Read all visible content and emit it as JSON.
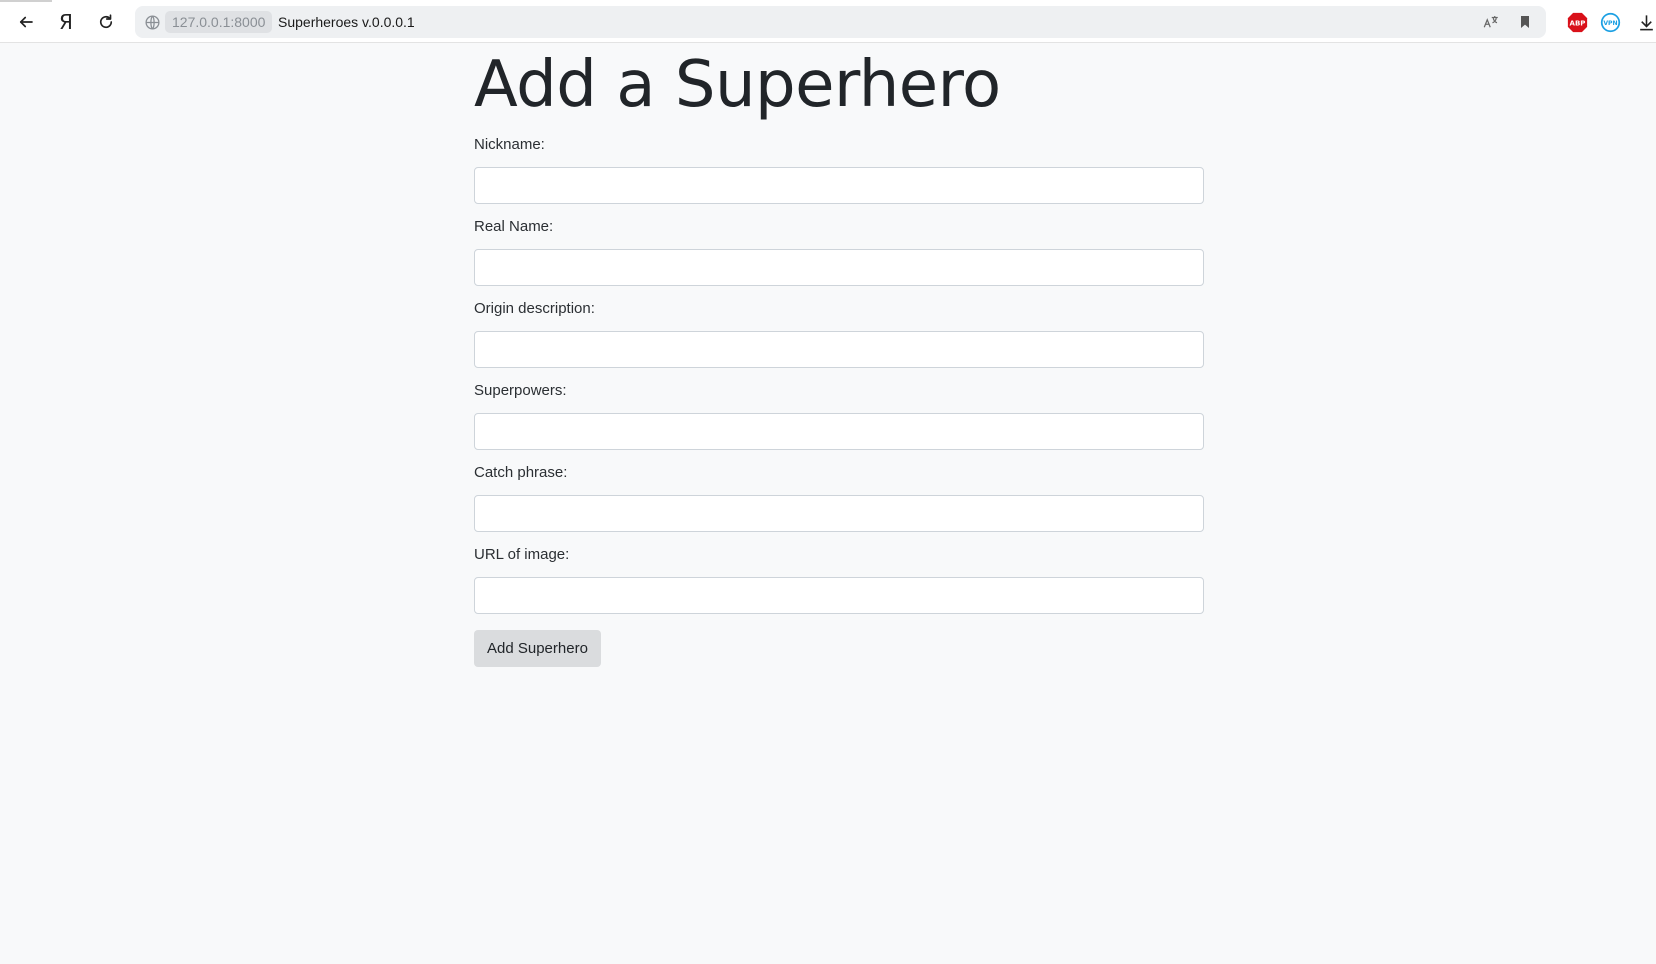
{
  "browser": {
    "host": "127.0.0.1:8000",
    "page_title": "Superheroes v.0.0.0.1",
    "icons": {
      "back": "back-arrow-icon",
      "yandex": "yandex-icon",
      "reload": "reload-icon",
      "site_info": "globe-icon",
      "translate": "translate-icon",
      "bookmark": "bookmark-icon",
      "adblock": "adblock-plus-icon",
      "vpn": "vpn-icon",
      "downloads": "download-icon"
    },
    "yandex_glyph": "Я",
    "adblock_text": "ABP",
    "vpn_text": "VPN",
    "colors": {
      "adblock": "#d9111a",
      "vpn": "#1ca0e3"
    }
  },
  "page": {
    "heading": "Add a Superhero",
    "fields": [
      {
        "label": "Nickname:",
        "value": ""
      },
      {
        "label": "Real Name:",
        "value": ""
      },
      {
        "label": "Origin description:",
        "value": ""
      },
      {
        "label": "Superpowers:",
        "value": ""
      },
      {
        "label": "Catch phrase:",
        "value": ""
      },
      {
        "label": "URL of image:",
        "value": ""
      }
    ],
    "submit_label": "Add Superhero"
  }
}
